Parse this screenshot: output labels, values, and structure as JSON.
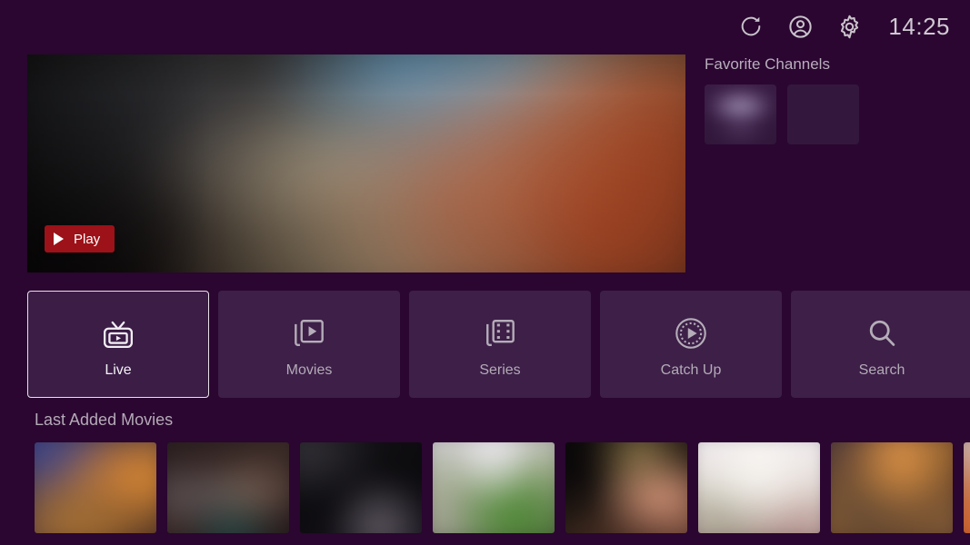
{
  "header": {
    "icons": [
      {
        "name": "refresh-icon",
        "label": "Refresh"
      },
      {
        "name": "account-icon",
        "label": "Account"
      },
      {
        "name": "gear-icon",
        "label": "Settings"
      }
    ],
    "clock": "14:25"
  },
  "hero": {
    "play_label": "Play",
    "play_icon": "play-triangle-icon",
    "play_bg": "#9c1218"
  },
  "favorites": {
    "title": "Favorite Channels",
    "channels": [
      {
        "variant": "v0"
      },
      {
        "variant": "v1"
      }
    ]
  },
  "nav": {
    "items": [
      {
        "label": "Live",
        "icon": "live-tv-icon",
        "selected": true
      },
      {
        "label": "Movies",
        "icon": "movies-stack-icon",
        "selected": false
      },
      {
        "label": "Series",
        "icon": "film-strip-icon",
        "selected": false
      },
      {
        "label": "Catch Up",
        "icon": "catch-up-icon",
        "selected": false
      },
      {
        "label": "Search",
        "icon": "search-icon",
        "selected": false
      },
      {
        "label": "",
        "icon": "",
        "selected": false
      }
    ]
  },
  "last_added": {
    "title": "Last Added Movies",
    "posters": [
      {
        "variant": "p0"
      },
      {
        "variant": "p1"
      },
      {
        "variant": "p2"
      },
      {
        "variant": "p3"
      },
      {
        "variant": "p4"
      },
      {
        "variant": "p5"
      },
      {
        "variant": "p6"
      },
      {
        "variant": "p7"
      }
    ]
  },
  "colors": {
    "background": "#2a0630",
    "tile": "#3d1f48",
    "selected_border": "#e8e2ea",
    "text_dim": "#b3abb6",
    "text_bright": "#f4f1f5"
  }
}
